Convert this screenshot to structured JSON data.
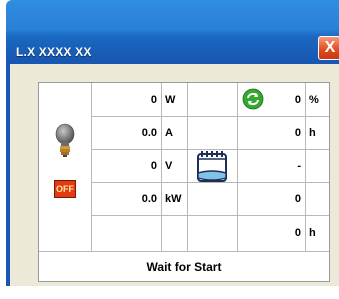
{
  "window": {
    "title": "L.X XXXX XX",
    "close_label": "X"
  },
  "left": {
    "off_label": "OFF"
  },
  "middle_values": [
    {
      "value": "0",
      "unit": "W"
    },
    {
      "value": "0.0",
      "unit": "A"
    },
    {
      "value": "0",
      "unit": "V"
    },
    {
      "value": "0.0",
      "unit": "kW"
    },
    {
      "value": "",
      "unit": ""
    }
  ],
  "right_values": [
    {
      "value": "0",
      "unit": "%"
    },
    {
      "value": "0",
      "unit": "h"
    },
    {
      "value": "-",
      "unit": ""
    },
    {
      "value": "0",
      "unit": ""
    },
    {
      "value": "0",
      "unit": "h"
    }
  ],
  "status": {
    "text": "Wait for Start"
  }
}
